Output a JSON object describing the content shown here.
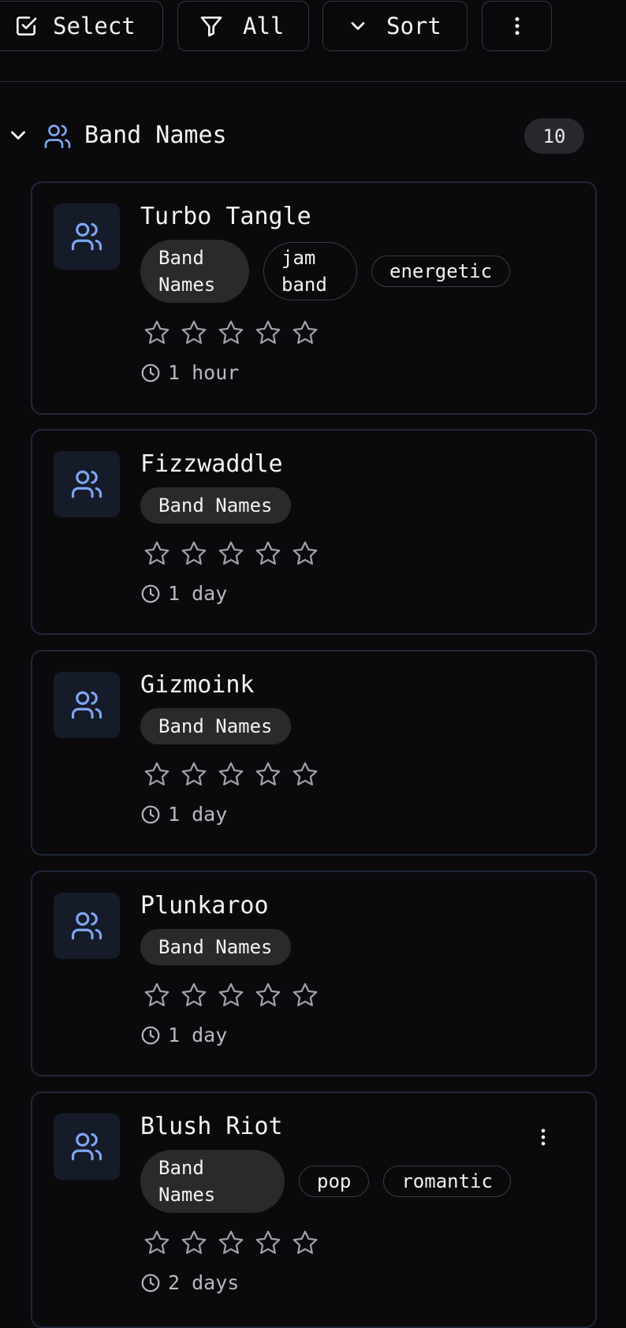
{
  "toolbar": {
    "select_label": "Select",
    "filter_label": "All",
    "sort_label": "Sort"
  },
  "group": {
    "title": "Band Names",
    "count": "10"
  },
  "colors": {
    "background": "#0a0a0c",
    "accent_icon": "#7ea6f2",
    "card_border": "#20273a",
    "icon_tile": "#161b29",
    "tag_fill": "#2a2a2d",
    "star_stroke": "#9fa0a8"
  },
  "cards": [
    {
      "title": "Turbo Tangle",
      "tags": [
        "Band Names",
        "jam band",
        "energetic"
      ],
      "rating": 0,
      "time": "1 hour"
    },
    {
      "title": "Fizzwaddle",
      "tags": [
        "Band Names"
      ],
      "rating": 0,
      "time": "1 day"
    },
    {
      "title": "Gizmoink",
      "tags": [
        "Band Names"
      ],
      "rating": 0,
      "time": "1 day"
    },
    {
      "title": "Plunkaroo",
      "tags": [
        "Band Names"
      ],
      "rating": 0,
      "time": "1 day"
    },
    {
      "title": "Blush Riot",
      "tags": [
        "Band Names",
        "pop",
        "romantic"
      ],
      "rating": 0,
      "time": "2 days"
    }
  ],
  "icons": {
    "select": "checkbox-icon",
    "filter": "funnel-icon",
    "sort": "chevron-down-icon",
    "more": "vertical-dots-icon",
    "group": "users-icon",
    "card": "users-icon",
    "star": "star-outline-icon",
    "time": "clock-icon"
  }
}
